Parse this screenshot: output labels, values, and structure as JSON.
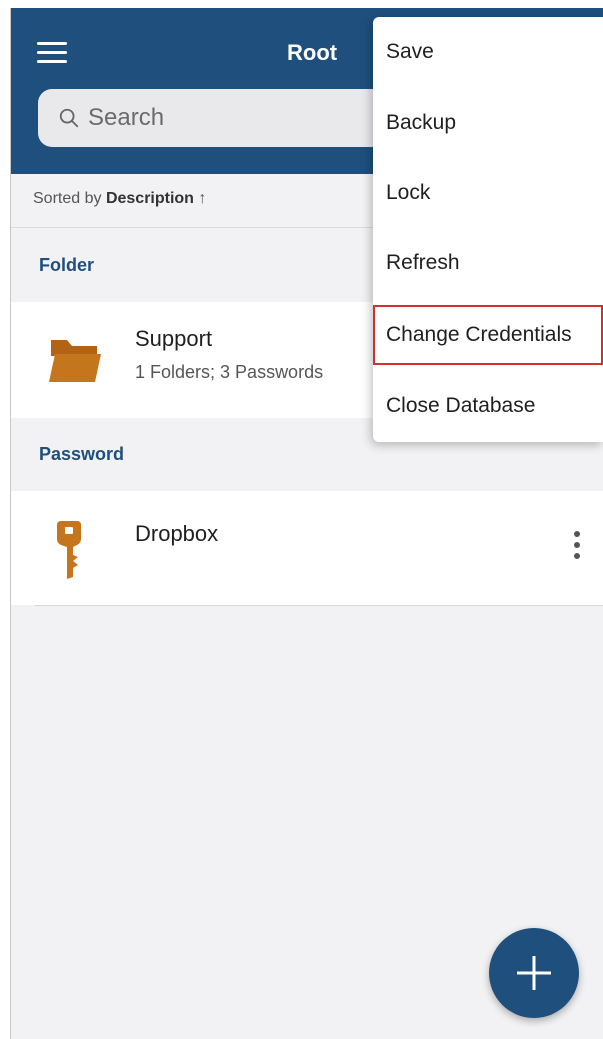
{
  "header": {
    "title": "Root",
    "search_placeholder": "Search"
  },
  "sort": {
    "prefix": "Sorted by",
    "field": "Description",
    "arrow": "↑"
  },
  "sections": {
    "folder_label": "Folder",
    "password_label": "Password"
  },
  "folder_item": {
    "name": "Support",
    "details": "1 Folders; 3 Passwords"
  },
  "password_item": {
    "name": "Dropbox"
  },
  "menu": {
    "items": [
      "Save",
      "Backup",
      "Lock",
      "Refresh",
      "Change Credentials",
      "Close Database"
    ],
    "highlighted": "Change Credentials"
  },
  "icons": {
    "menu": "hamburger-icon",
    "search": "search-icon",
    "folder": "folder-icon",
    "key": "key-icon",
    "more": "more-vertical-icon",
    "add": "plus-icon"
  },
  "colors": {
    "primary": "#1e4f7d",
    "accent_orange": "#c5761c",
    "highlight_border": "#d32f2f"
  }
}
